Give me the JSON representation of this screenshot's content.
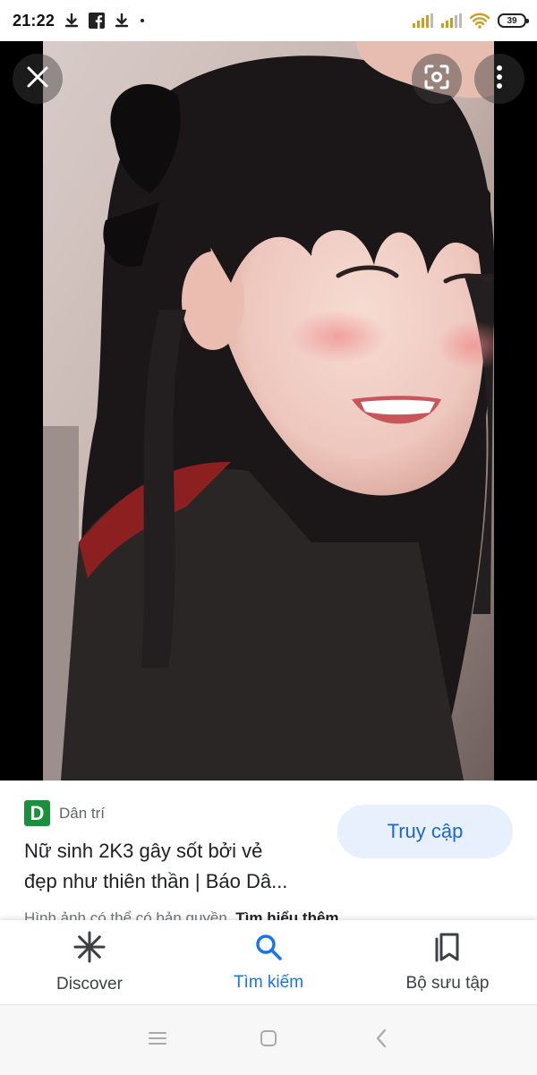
{
  "status_bar": {
    "time": "21:22",
    "icons": [
      "download-icon",
      "facebook-icon",
      "download-icon",
      "dot-icon"
    ],
    "right_icons": [
      "signal-icon",
      "signal-icon",
      "wifi-icon"
    ],
    "battery": "39"
  },
  "viewer": {
    "close_icon": "close-icon",
    "lens_icon": "lens-icon",
    "menu_icon": "more-vert-icon"
  },
  "result": {
    "source_logo": "D",
    "source_name": "Dân trí",
    "title_line1": "Nữ sinh 2K3 gây sốt bởi vẻ",
    "title_line2": "đẹp như thiên thần | Báo Dâ...",
    "visit_label": "Truy cập",
    "copyright_text": "Hình ảnh có thể có bản quyền.",
    "learn_more": "Tìm hiểu thêm"
  },
  "bottom_nav": {
    "items": [
      {
        "label": "Discover",
        "icon": "asterisk-icon",
        "active": false
      },
      {
        "label": "Tìm kiếm",
        "icon": "search-icon",
        "active": true
      },
      {
        "label": "Bộ sưu tập",
        "icon": "collections-icon",
        "active": false
      }
    ]
  },
  "system_nav": [
    "menu-icon",
    "home-icon",
    "back-icon"
  ],
  "colors": {
    "accent": "#1a73e8",
    "visit_bg": "#e8f0fe",
    "source_green": "#1a8f3c"
  }
}
